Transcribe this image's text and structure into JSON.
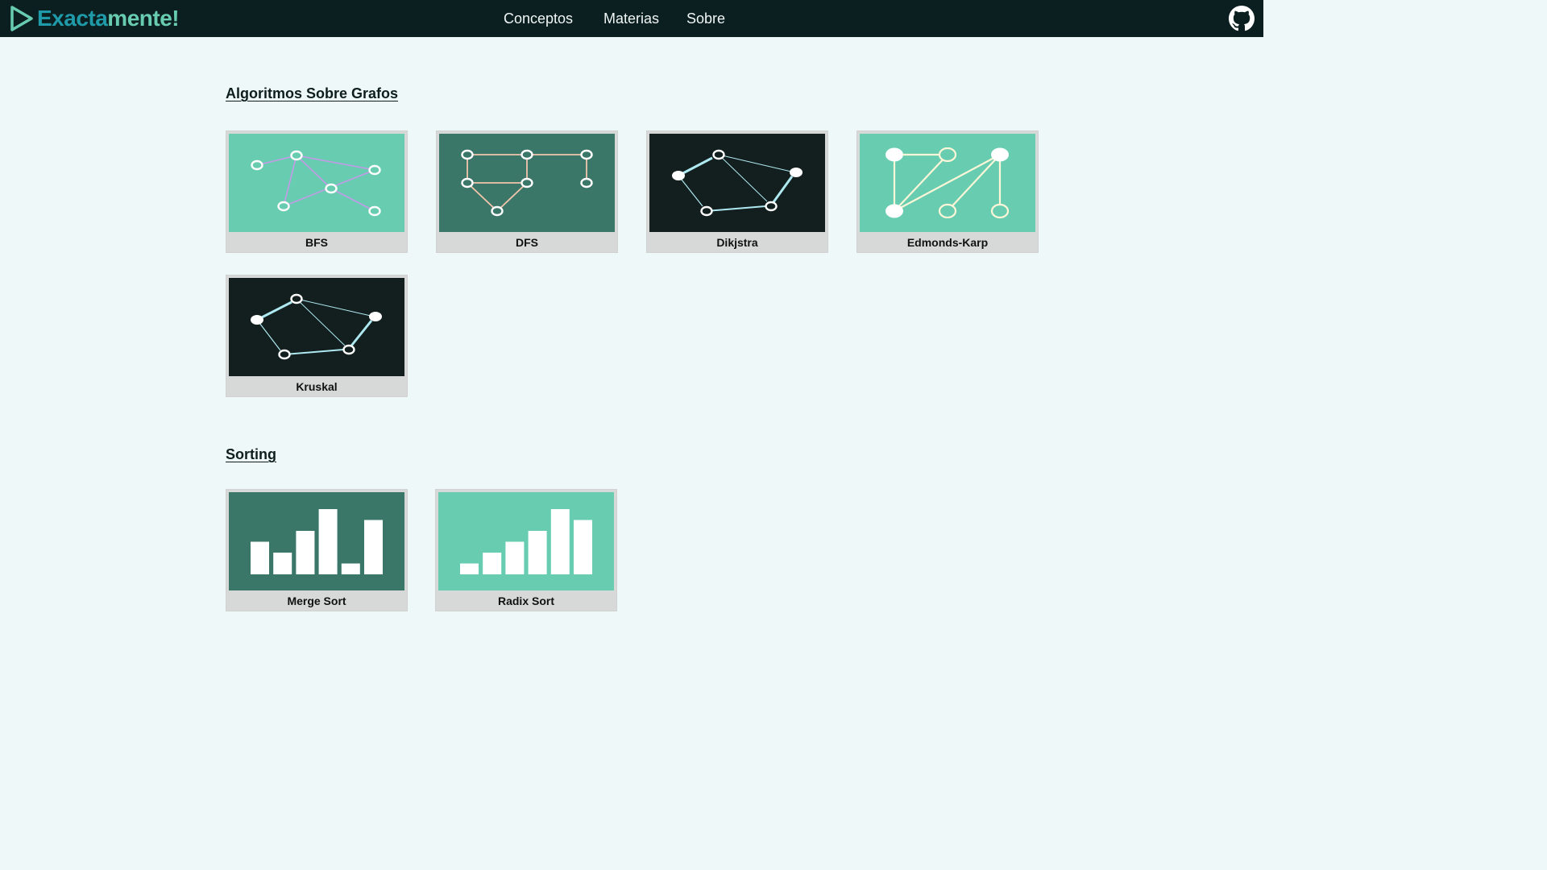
{
  "header": {
    "brand": {
      "part1": "Exacta",
      "part2": "mente",
      "part3": "!"
    },
    "nav": [
      {
        "label": "Conceptos"
      },
      {
        "label": "Materias"
      },
      {
        "label": "Sobre"
      }
    ],
    "github_icon": "github-icon"
  },
  "sections": [
    {
      "title": "Algoritmos Sobre Grafos",
      "cards": [
        {
          "label": "BFS",
          "theme": "mint"
        },
        {
          "label": "DFS",
          "theme": "teal"
        },
        {
          "label": "Dikjstra",
          "theme": "dark"
        },
        {
          "label": "Edmonds-Karp",
          "theme": "mint"
        },
        {
          "label": "Kruskal",
          "theme": "dark"
        }
      ]
    },
    {
      "title": "Sorting",
      "cards": [
        {
          "label": "Merge Sort",
          "theme": "teal",
          "bars": [
            3,
            2,
            4,
            6,
            1,
            5
          ]
        },
        {
          "label": "Radix Sort",
          "theme": "mint",
          "bars": [
            1,
            2,
            3,
            4,
            6,
            5
          ]
        }
      ]
    }
  ],
  "colors": {
    "header_bg": "#0c1f20",
    "page_bg": "#eff8f9",
    "mint": "#68cdb0",
    "teal": "#3a7769",
    "dark": "#121f1e",
    "card_bg": "#d7d9d8"
  }
}
